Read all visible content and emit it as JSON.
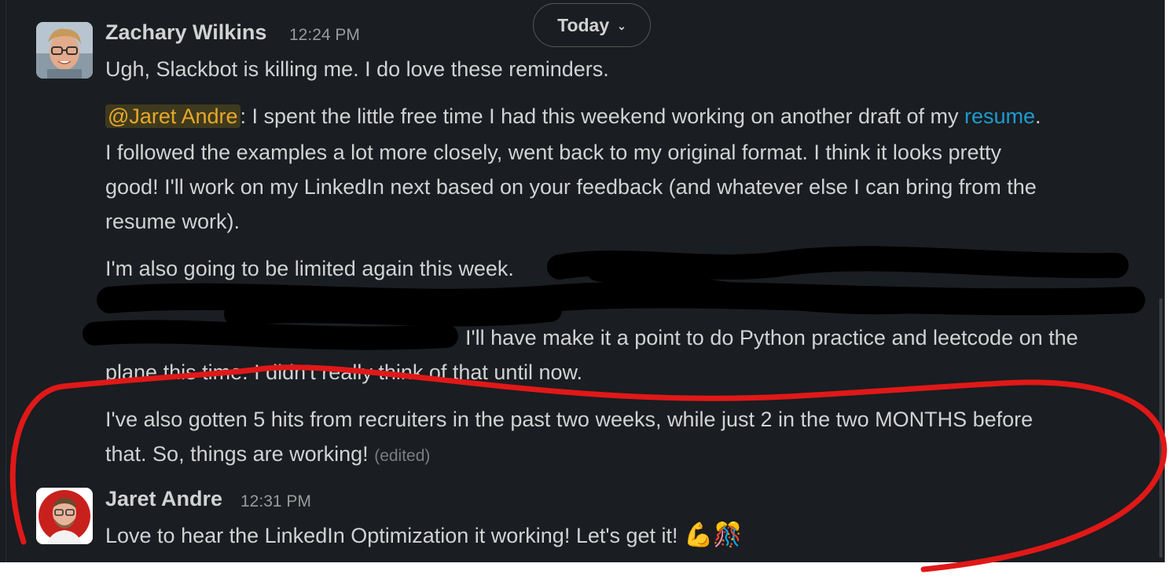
{
  "date_divider": {
    "label": "Today"
  },
  "messages": [
    {
      "author": "Zachary Wilkins",
      "time": "12:24 PM",
      "line1": "Ugh, Slackbot is killing me.  I do love these reminders.",
      "p2_mention": "@Jaret Andre",
      "p2_after_mention": ": I spent the little free time I had this weekend working on another draft of my ",
      "p2_link": "resume",
      "p2_end": ".",
      "p2_l2": "I followed the examples a lot more closely, went back to my original format.  I think it looks pretty",
      "p2_l3": "good!  I'll work on my LinkedIn next based on your feedback (and whatever else I can bring from the",
      "p2_l4": "resume work).",
      "p3_l1": "I'm also going to be limited again this week.",
      "p3_l3": "I'll have make it a point to do Python practice and leetcode on the",
      "p3_l4": "plane this time.  I didn't really think of that until now.",
      "p4_l1": "I've also gotten 5 hits from recruiters in the past two weeks, while just 2 in the two MONTHS before",
      "p4_l2": "that.  So, things are working!",
      "edited": "(edited)"
    },
    {
      "author": "Jaret Andre",
      "time": "12:31 PM",
      "text": "Love to hear the LinkedIn Optimization it working! Let's get it! ",
      "emoji": "💪🎊"
    }
  ],
  "colors": {
    "background": "#1a1d21",
    "text": "#d1d2d3",
    "mention": "#e8a82a",
    "link": "#1d9bd1",
    "annotation": "#e01818"
  }
}
